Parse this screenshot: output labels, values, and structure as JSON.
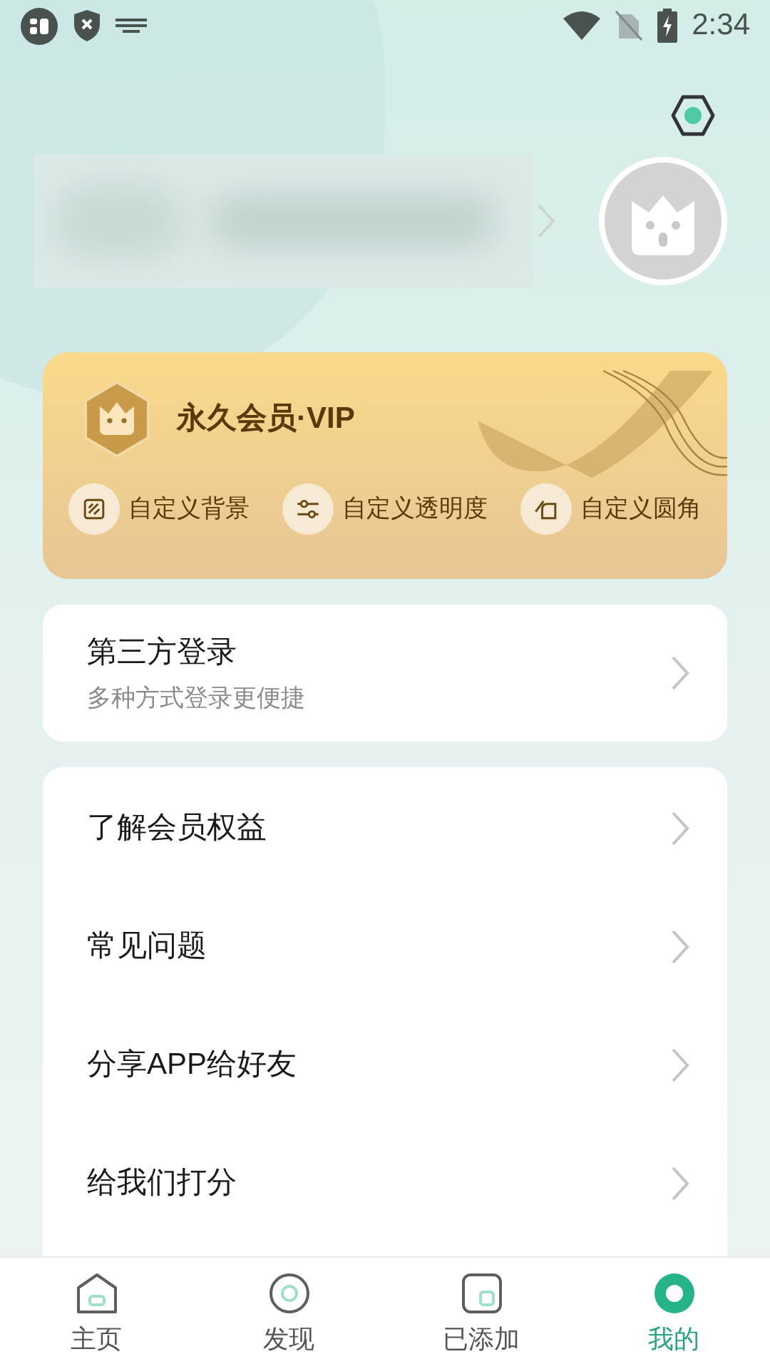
{
  "status_bar": {
    "time": "2:34"
  },
  "vip_card": {
    "title": "永久会员·VIP",
    "features": [
      {
        "kind": "background",
        "label": "自定义背景"
      },
      {
        "kind": "opacity",
        "label": "自定义透明度"
      },
      {
        "kind": "corner",
        "label": "自定义圆角"
      }
    ]
  },
  "login_card": {
    "title": "第三方登录",
    "subtitle": "多种方式登录更便捷"
  },
  "menu": [
    {
      "label": "了解会员权益"
    },
    {
      "label": "常见问题"
    },
    {
      "label": "分享APP给好友"
    },
    {
      "label": "给我们打分"
    }
  ],
  "tabs": [
    {
      "kind": "home",
      "label": "主页",
      "selected": false
    },
    {
      "kind": "discover",
      "label": "发现",
      "selected": false
    },
    {
      "kind": "added",
      "label": "已添加",
      "selected": false
    },
    {
      "kind": "mine",
      "label": "我的",
      "selected": true
    }
  ]
}
